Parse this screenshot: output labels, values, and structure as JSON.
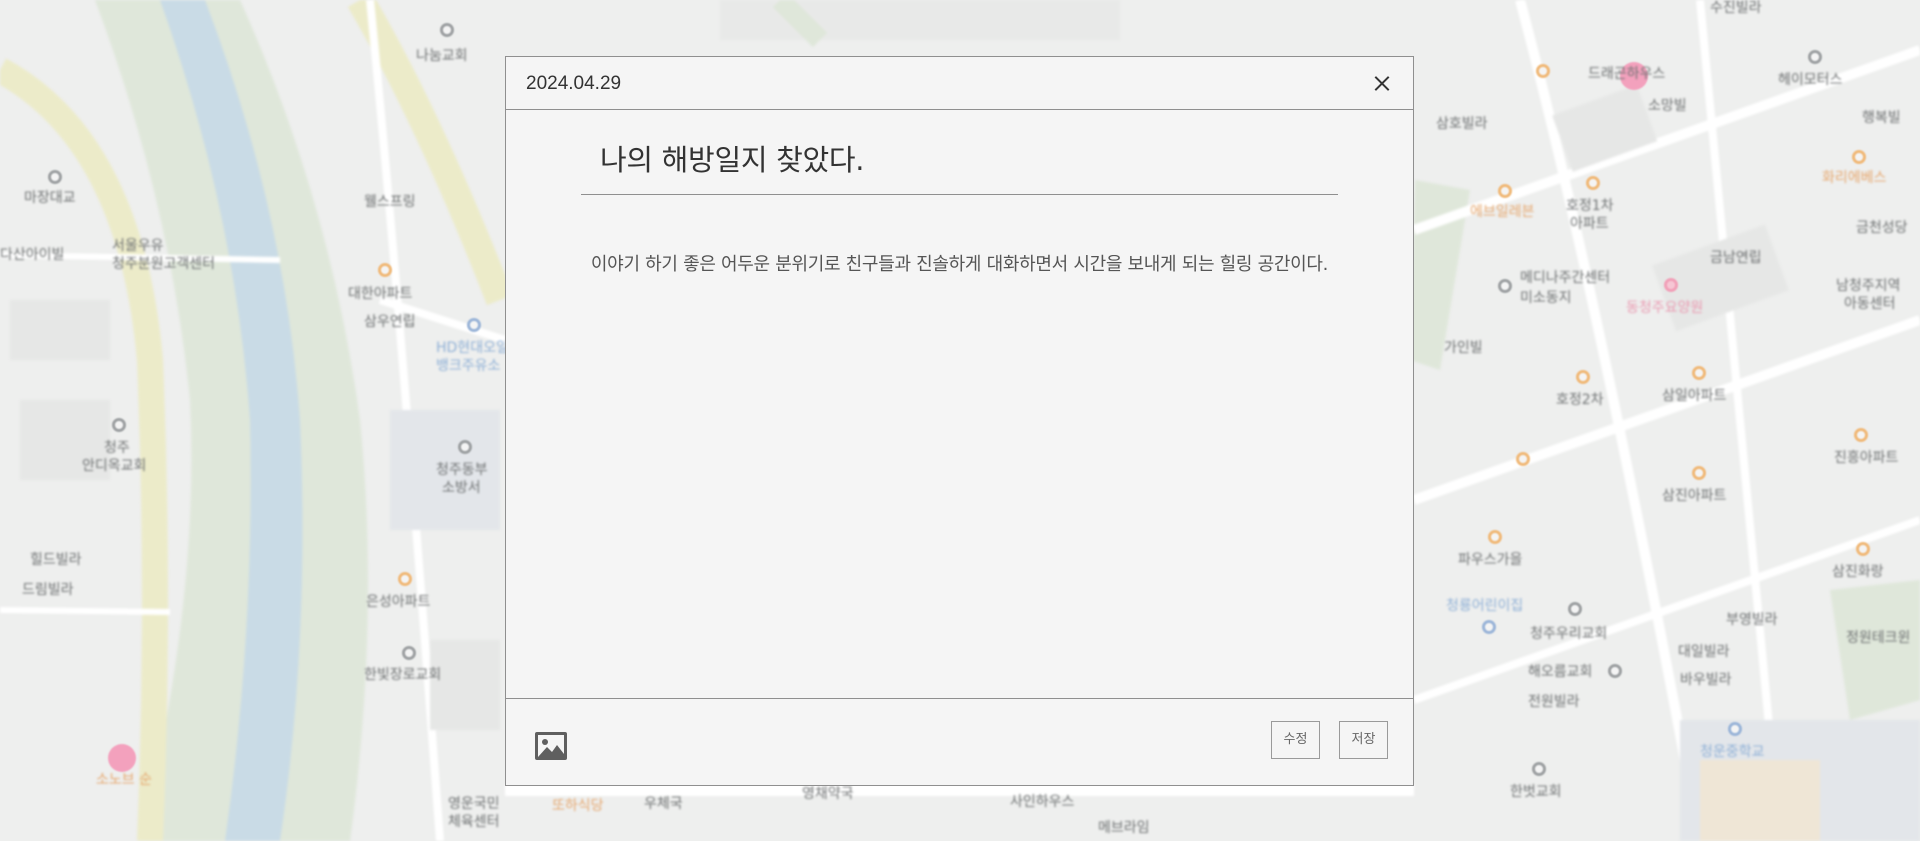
{
  "map": {
    "labels": [
      {
        "text": "마장대교",
        "cls": ""
      },
      {
        "text": "다산아이빌",
        "cls": ""
      },
      {
        "text": "서울우유",
        "cls": ""
      },
      {
        "text": "청주분원고객센터",
        "cls": ""
      },
      {
        "text": "나눔교회",
        "cls": ""
      },
      {
        "text": "웰스프링",
        "cls": ""
      },
      {
        "text": "대한아파트",
        "cls": ""
      },
      {
        "text": "삼우연립",
        "cls": ""
      },
      {
        "text": "HD현대오일",
        "cls": "blue"
      },
      {
        "text": "뱅크주유소",
        "cls": "blue"
      },
      {
        "text": "청주",
        "cls": ""
      },
      {
        "text": "안디옥교회",
        "cls": ""
      },
      {
        "text": "청주동부",
        "cls": ""
      },
      {
        "text": "소방서",
        "cls": ""
      },
      {
        "text": "힐드빌라",
        "cls": ""
      },
      {
        "text": "드림빌라",
        "cls": ""
      },
      {
        "text": "은성아파트",
        "cls": ""
      },
      {
        "text": "한빛장로교회",
        "cls": ""
      },
      {
        "text": "소노브 순",
        "cls": "orange"
      },
      {
        "text": "영운국민",
        "cls": ""
      },
      {
        "text": "체육센터",
        "cls": ""
      },
      {
        "text": "또하식당",
        "cls": "orange"
      },
      {
        "text": "우체국",
        "cls": ""
      },
      {
        "text": "영채약국",
        "cls": ""
      },
      {
        "text": "사인하우스",
        "cls": ""
      },
      {
        "text": "메브라임",
        "cls": ""
      },
      {
        "text": "드래곤하우스",
        "cls": ""
      },
      {
        "text": "소망빌",
        "cls": ""
      },
      {
        "text": "수진빌라",
        "cls": ""
      },
      {
        "text": "헤이모터스",
        "cls": ""
      },
      {
        "text": "행복빌",
        "cls": ""
      },
      {
        "text": "화리에베스",
        "cls": "orange"
      },
      {
        "text": "금천성당",
        "cls": ""
      },
      {
        "text": "삼호빌라",
        "cls": ""
      },
      {
        "text": "호정1차",
        "cls": ""
      },
      {
        "text": "아파트",
        "cls": ""
      },
      {
        "text": "에브일레븐",
        "cls": "orange"
      },
      {
        "text": "금남연립",
        "cls": ""
      },
      {
        "text": "메디나주간센터",
        "cls": ""
      },
      {
        "text": "미소동지",
        "cls": ""
      },
      {
        "text": "동청주요양원",
        "cls": "pink"
      },
      {
        "text": "남청주지역",
        "cls": ""
      },
      {
        "text": "아동센터",
        "cls": ""
      },
      {
        "text": "가인빌",
        "cls": ""
      },
      {
        "text": "호정2차",
        "cls": ""
      },
      {
        "text": "삼일아파트",
        "cls": ""
      },
      {
        "text": "진흥아파트",
        "cls": ""
      },
      {
        "text": "삼진아파트",
        "cls": ""
      },
      {
        "text": "파우스가을",
        "cls": ""
      },
      {
        "text": "삼진화랑",
        "cls": ""
      },
      {
        "text": "청룡어린이집",
        "cls": "blue"
      },
      {
        "text": "청주우리교회",
        "cls": ""
      },
      {
        "text": "부영빌라",
        "cls": ""
      },
      {
        "text": "대일빌라",
        "cls": ""
      },
      {
        "text": "해오름교회",
        "cls": ""
      },
      {
        "text": "바우빌라",
        "cls": ""
      },
      {
        "text": "전원빌라",
        "cls": ""
      },
      {
        "text": "청운중학교",
        "cls": "blue"
      },
      {
        "text": "한벗교회",
        "cls": ""
      },
      {
        "text": "정원테크윈",
        "cls": ""
      }
    ]
  },
  "modal": {
    "date": "2024.04.29",
    "title": "나의 해방일지 찾았다.",
    "body": "이야기 하기 좋은 어두운 분위기로 친구들과 진솔하게 대화하면서 시간을 보내게 되는 힐링 공간이다.",
    "edit_label": "수정",
    "save_label": "저장",
    "icons": {
      "close": "close-icon",
      "image": "image-icon"
    }
  }
}
